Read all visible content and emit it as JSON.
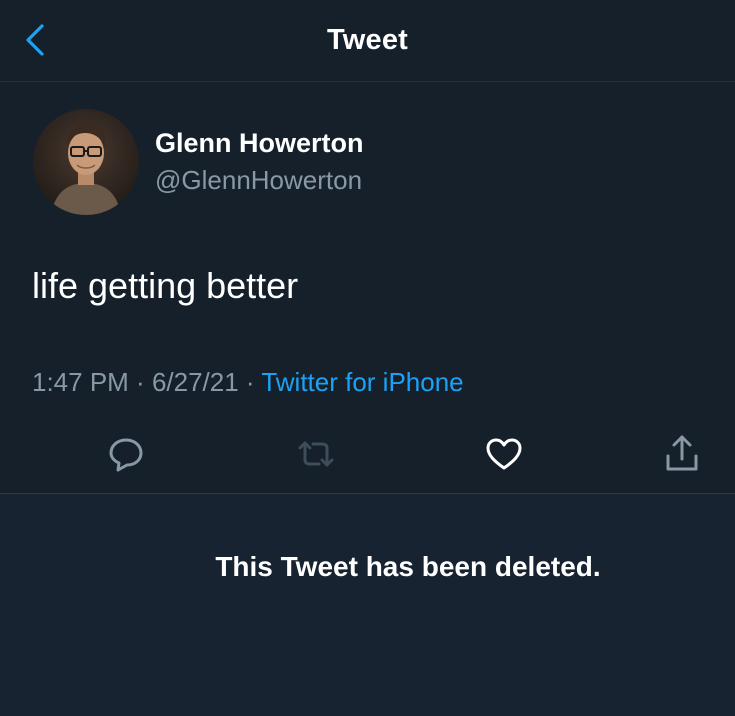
{
  "header": {
    "title": "Tweet",
    "back_icon": "chevron-left-icon"
  },
  "tweet": {
    "author": {
      "display_name": "Glenn Howerton",
      "handle": "@GlennHowerton"
    },
    "text": "life getting better",
    "time": "1:47 PM",
    "separator": " · ",
    "date": "6/27/21",
    "source": "Twitter for iPhone",
    "actions": [
      {
        "name": "reply",
        "icon": "reply-bubble-icon"
      },
      {
        "name": "retweet",
        "icon": "retweet-icon"
      },
      {
        "name": "like",
        "icon": "heart-icon"
      },
      {
        "name": "share",
        "icon": "share-icon"
      }
    ]
  },
  "deleted_notice": {
    "text": "This Tweet has been deleted."
  },
  "colors": {
    "background": "#15202b",
    "accent": "#1da1f2",
    "secondary_text": "#8899a6",
    "primary_text": "#ffffff"
  }
}
